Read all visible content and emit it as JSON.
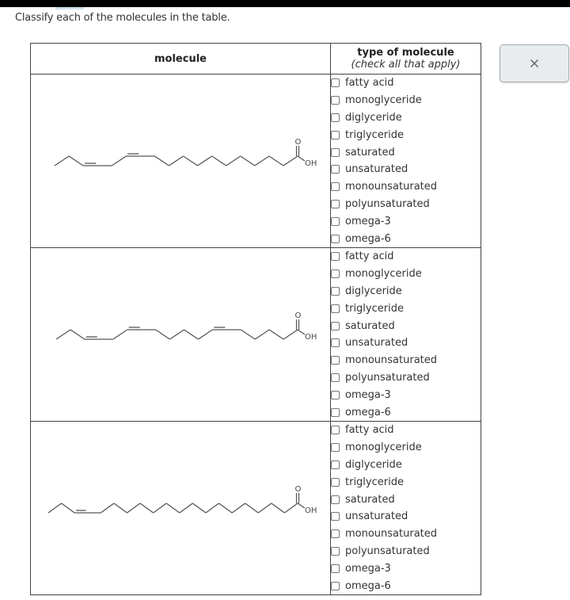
{
  "prompt": "Classify each of the molecules in the table.",
  "table": {
    "headers": {
      "molecule": "molecule",
      "type_title": "type of molecule",
      "type_subtitle": "(check all that apply)"
    },
    "options": [
      "fatty acid",
      "monoglyceride",
      "diglyceride",
      "triglyceride",
      "saturated",
      "unsaturated",
      "monounsaturated",
      "polyunsaturated",
      "omega-3",
      "omega-6"
    ],
    "rows": [
      {
        "molecule": {
          "carbons": 18,
          "double_bonds_from_omega_end": [
            3,
            6
          ],
          "label_O": "O",
          "label_OH": "OH"
        },
        "checked": [
          false,
          false,
          false,
          false,
          false,
          false,
          false,
          false,
          false,
          false
        ]
      },
      {
        "molecule": {
          "carbons": 18,
          "double_bonds_from_omega_end": [
            3,
            6,
            12
          ],
          "label_O": "O",
          "label_OH": "OH"
        },
        "checked": [
          false,
          false,
          false,
          false,
          false,
          false,
          false,
          false,
          false,
          false
        ]
      },
      {
        "molecule": {
          "carbons": 20,
          "double_bonds_from_omega_end": [
            3
          ],
          "label_O": "O",
          "label_OH": "OH"
        },
        "checked": [
          false,
          false,
          false,
          false,
          false,
          false,
          false,
          false,
          false,
          false
        ]
      }
    ]
  },
  "close_button": {
    "icon": "close-icon",
    "label": "×"
  }
}
